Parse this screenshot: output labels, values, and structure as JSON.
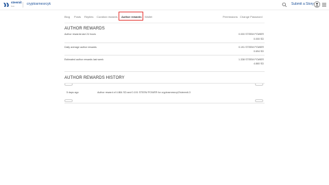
{
  "header": {
    "logo_text": "steemit",
    "logo_sub": "beta",
    "username": "cryptosrnesrcyk",
    "submit_label": "Submit a Story"
  },
  "tabs": {
    "items": [
      "Blog",
      "Posts",
      "Replies",
      "Curation rewards",
      "Author rewards",
      "Wallet"
    ],
    "right": [
      "Permissions",
      "Change Password"
    ],
    "active": "Author rewards"
  },
  "author_rewards": {
    "title": "AUTHOR REWARDS",
    "rows": [
      {
        "label": "Author rewards last 24 hours",
        "value1": "0.000 STEEM POWER",
        "value2": "0.000 SD"
      },
      {
        "label": "Daily average author rewards",
        "value1": "0.191 STEEM POWER",
        "value2": "0.694 SD"
      },
      {
        "label": "Estimated author rewards last week",
        "value1": "1.338 STEEM POWER",
        "value2": "4.860 SD"
      }
    ]
  },
  "history": {
    "title": "AUTHOR REWARDS HISTORY",
    "entry": {
      "time": "5 days ago",
      "description": "Author reward of 4.864 SD and 0.191 STEEM POWER for cryptosrnesrcy/2/steemit-3"
    }
  },
  "colors": {
    "brand": "#1a5099",
    "highlight": "#e53935"
  }
}
